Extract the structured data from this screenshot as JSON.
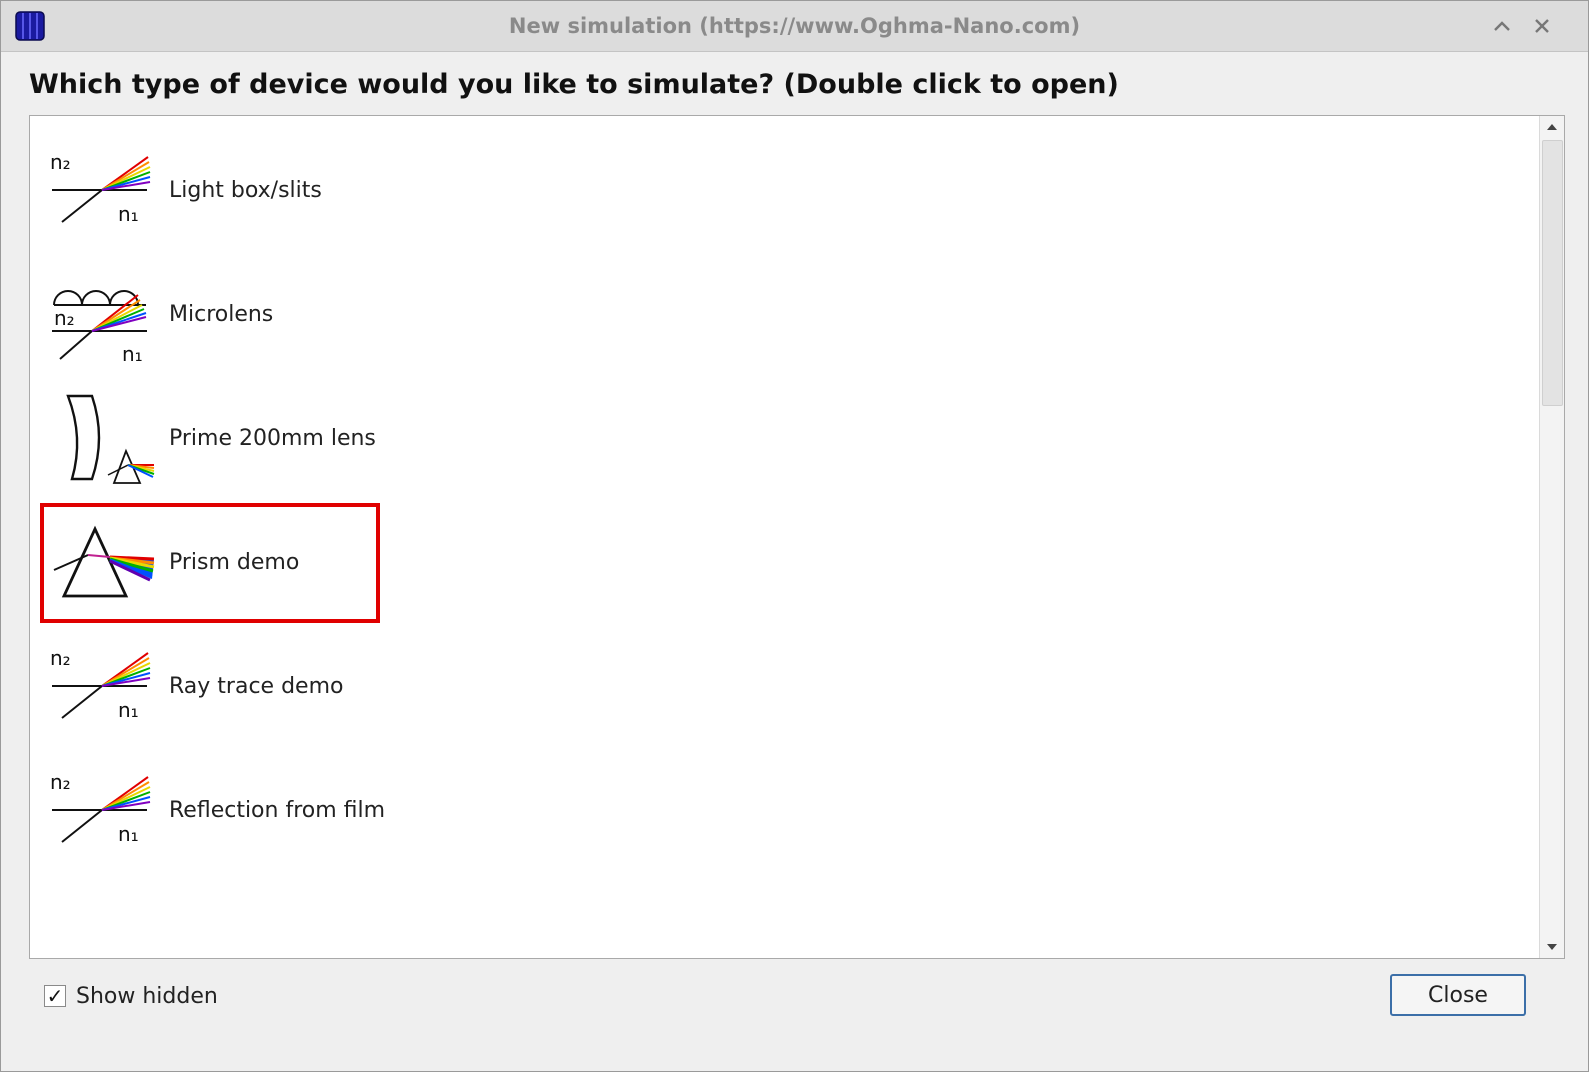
{
  "window": {
    "title": "New simulation (https://www.Oghma-Nano.com)",
    "app_icon": "solar-cell-app-icon",
    "controls": [
      "maximize-icon",
      "close-icon"
    ]
  },
  "heading": "Which type of device would you like to simulate? (Double click to open)",
  "devices": [
    {
      "label": "Light box/slits",
      "icon": "refraction-icon"
    },
    {
      "label": "Microlens",
      "icon": "microlens-icon"
    },
    {
      "label": "Prime 200mm lens",
      "icon": "lens-icon"
    },
    {
      "label": "Prism demo",
      "icon": "prism-icon",
      "selected": true
    },
    {
      "label": "Ray trace demo",
      "icon": "refraction-icon"
    },
    {
      "label": "Reflection from film",
      "icon": "refraction-icon"
    }
  ],
  "refraction_labels": {
    "upper": "n₂",
    "lower": "n₁"
  },
  "footer": {
    "show_hidden_label": "Show hidden",
    "show_hidden_checked": true,
    "close_label": "Close"
  },
  "colors": {
    "selection": "#e00000",
    "button_border": "#3c6fa8",
    "title_text": "#8a8a8a"
  }
}
